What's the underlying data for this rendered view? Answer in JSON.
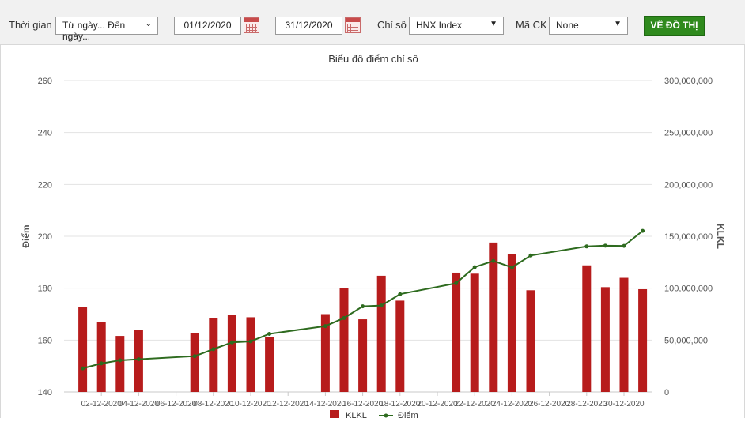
{
  "toolbar": {
    "time_label": "Thời gian",
    "time_select": "Từ ngày... Đến ngày...",
    "from_date": "01/12/2020",
    "to_date": "31/12/2020",
    "index_label": "Chỉ số",
    "index_select": "HNX Index",
    "stock_label": "Mã CK",
    "stock_select": "None",
    "draw_button": "VẼ ĐỒ THỊ"
  },
  "colors": {
    "bar": "#b71c1c",
    "line": "#2e6b1f",
    "button": "#2f8a1d"
  },
  "chart_data": {
    "type": "bar",
    "title": "Biểu đồ điểm chỉ số",
    "ylabel_left": "Điểm",
    "ylabel_right": "KLKL",
    "ylim_left": [
      140,
      260
    ],
    "ylim_right": [
      0,
      300000000
    ],
    "yticks_left": [
      "260",
      "240",
      "220",
      "200",
      "180",
      "160",
      "140"
    ],
    "yticks_right": [
      "300,000,000",
      "250,000,000",
      "200,000,000",
      "150,000,000",
      "100,000,000",
      "50,000,000",
      "0"
    ],
    "xticks": [
      "02-12-2020",
      "04-12-2020",
      "06-12-2020",
      "08-12-2020",
      "10-12-2020",
      "12-12-2020",
      "14-12-2020",
      "16-12-2020",
      "18-12-2020",
      "20-12-2020",
      "22-12-2020",
      "24-12-2020",
      "26-12-2020",
      "28-12-2020",
      "30-12-2020"
    ],
    "dates": [
      "01-12-2020",
      "02-12-2020",
      "03-12-2020",
      "04-12-2020",
      "07-12-2020",
      "08-12-2020",
      "09-12-2020",
      "10-12-2020",
      "11-12-2020",
      "14-12-2020",
      "15-12-2020",
      "16-12-2020",
      "17-12-2020",
      "18-12-2020",
      "21-12-2020",
      "22-12-2020",
      "23-12-2020",
      "24-12-2020",
      "25-12-2020",
      "28-12-2020",
      "29-12-2020",
      "30-12-2020",
      "31-12-2020"
    ],
    "series": [
      {
        "name": "KLKL",
        "type": "bar",
        "axis": "right",
        "values": [
          82000000,
          67000000,
          54000000,
          60000000,
          57000000,
          71000000,
          74000000,
          72000000,
          53000000,
          75000000,
          100000000,
          70000000,
          112000000,
          88000000,
          115000000,
          114000000,
          144000000,
          133000000,
          98000000,
          122000000,
          101000000,
          110000000,
          99000000
        ]
      },
      {
        "name": "Điểm",
        "type": "line",
        "axis": "left",
        "values": [
          149.1,
          151.0,
          152.2,
          152.6,
          153.8,
          156.5,
          159.1,
          159.5,
          162.4,
          165.4,
          168.5,
          173.0,
          173.3,
          177.7,
          181.9,
          188.1,
          190.5,
          188.0,
          192.6,
          196.1,
          196.4,
          196.3,
          202.1
        ]
      }
    ],
    "grid": true,
    "legend": "bottom-center"
  }
}
